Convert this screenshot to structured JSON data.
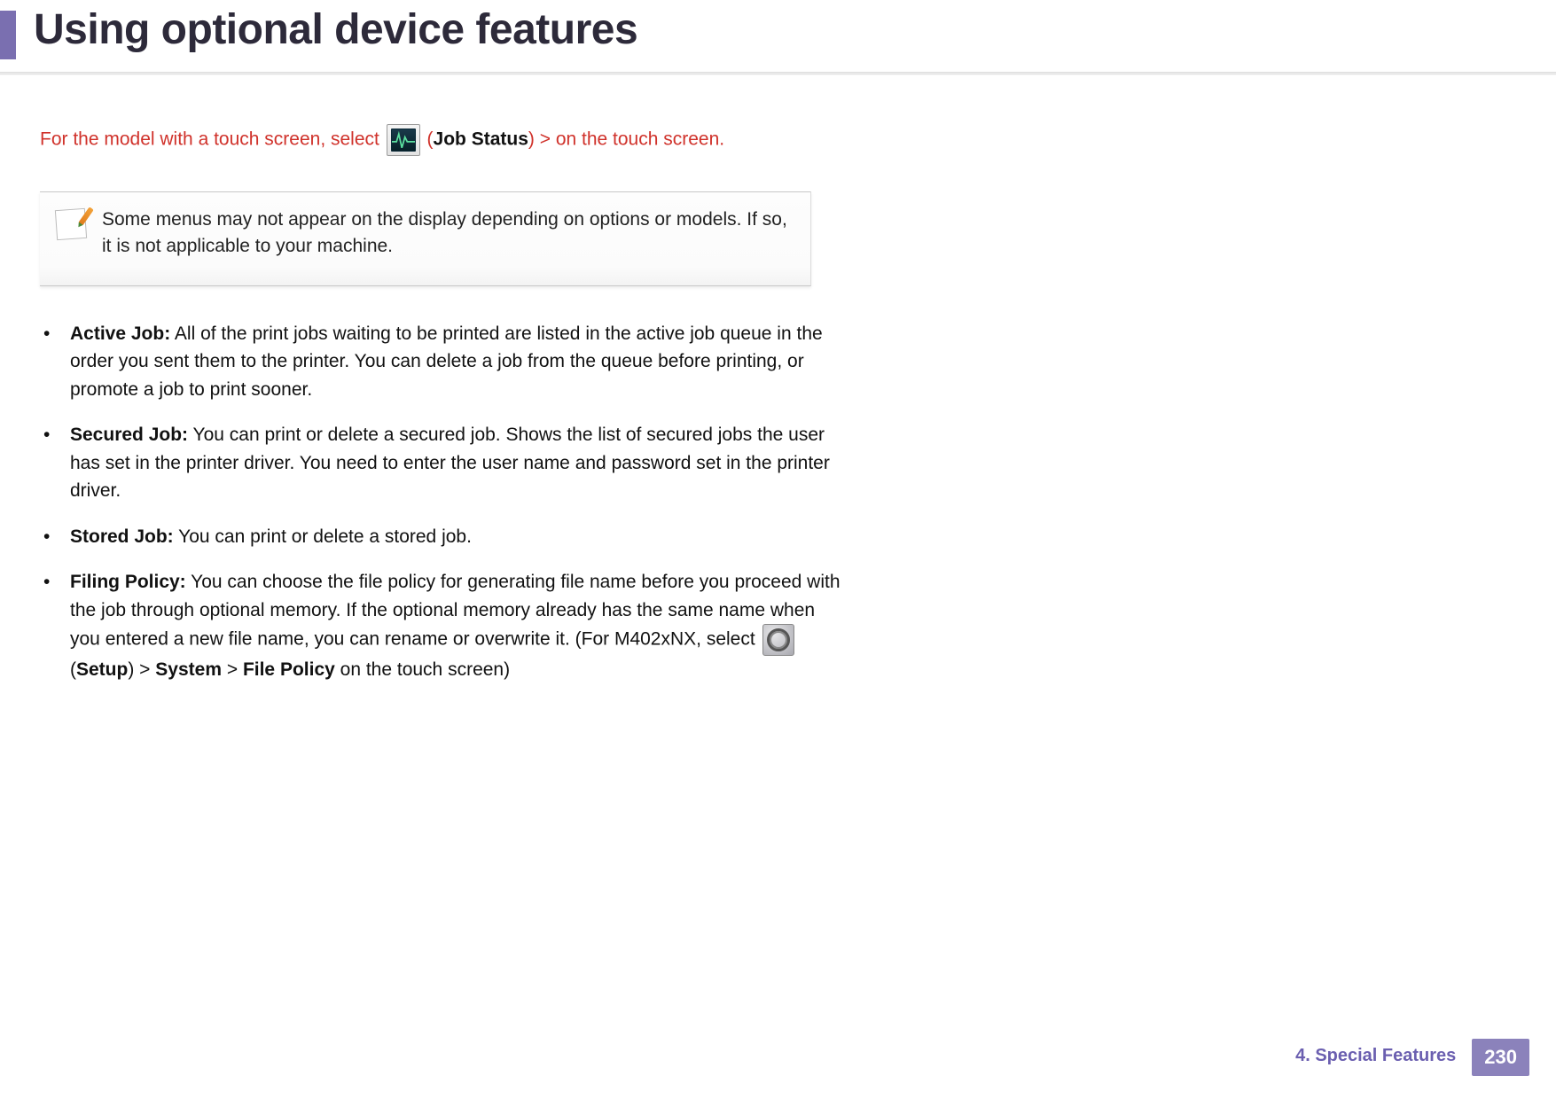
{
  "header": {
    "title": "Using optional device features"
  },
  "intro": {
    "pre": "For the model with a touch screen, select ",
    "paren_open": "(",
    "label": "Job Status",
    "paren_close": ")",
    "sep": " > ",
    "post": "on the touch screen."
  },
  "note": {
    "text": "Some menus may not appear on the display depending on options or models. If so, it is not applicable to your machine."
  },
  "features": [
    {
      "label": "Active Job:",
      "sep": "  ",
      "body": "All of the print jobs waiting to be printed are listed in the active job queue in the order you sent them to the printer. You can delete a job from the queue before printing, or promote a job to print sooner."
    },
    {
      "label": "Secured Job:",
      "sep": " ",
      "body": "You can print or delete a secured job. Shows the list of secured jobs the user has set in the printer driver. You need to enter the user name and password set in the printer driver."
    },
    {
      "label": "Stored Job:",
      "sep": " ",
      "body": "You can print or delete a stored job."
    },
    {
      "label": "Filing Policy:",
      "sep": "  ",
      "body_pre": "You can choose the file policy for generating file name before you proceed with the job through optional memory. If the optional memory already has the same name when you entered a new file name, you can rename or overwrite it. (For M402xNX, select ",
      "setup_open": "(",
      "setup_label": "Setup",
      "setup_close": ")",
      "gt1": " > ",
      "system": "System",
      "gt2": " > ",
      "file_policy": "File Policy",
      "body_post": " on the touch screen)"
    }
  ],
  "footer": {
    "chapter": "4.  Special Features",
    "page": "230"
  }
}
